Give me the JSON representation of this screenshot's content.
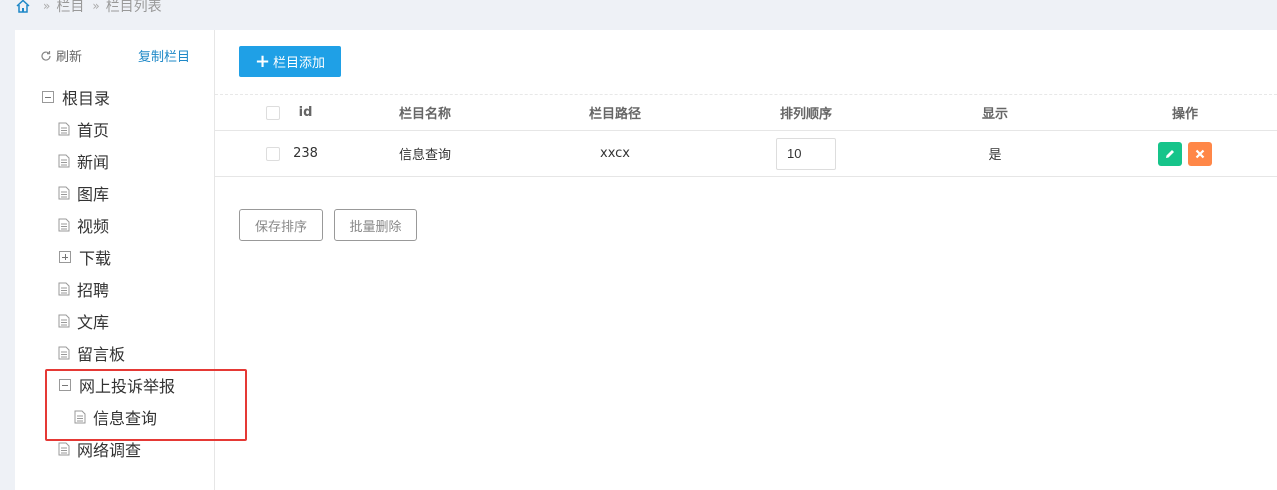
{
  "breadcrumb": {
    "items": [
      "栏目",
      "栏目列表"
    ],
    "separator": "»"
  },
  "sidebar": {
    "refresh_label": "刷新",
    "copy_label": "复制栏目",
    "tree": {
      "root": "根目录",
      "items": [
        "首页",
        "新闻",
        "图库",
        "视频",
        "下载",
        "招聘",
        "文库",
        "留言板",
        "网上投诉举报",
        "信息查询",
        "网络调查"
      ]
    }
  },
  "toolbar": {
    "add_label": "栏目添加"
  },
  "table": {
    "headers": {
      "id": "id",
      "name": "栏目名称",
      "path": "栏目路径",
      "order": "排列顺序",
      "display": "显示",
      "actions": "操作"
    },
    "rows": [
      {
        "id": "238",
        "name": "信息查询",
        "path": "xxcx",
        "order": "10",
        "display": "是"
      }
    ]
  },
  "footer": {
    "save_order_label": "保存排序",
    "batch_delete_label": "批量删除"
  },
  "colors": {
    "primary": "#1fa0e6",
    "edit": "#16c48a",
    "delete": "#ff8748",
    "highlight": "#e53935",
    "link": "#1e88c7"
  },
  "icons": [
    "home-icon",
    "refresh-icon",
    "doc-icon",
    "plus-icon",
    "pencil-icon",
    "close-icon"
  ]
}
